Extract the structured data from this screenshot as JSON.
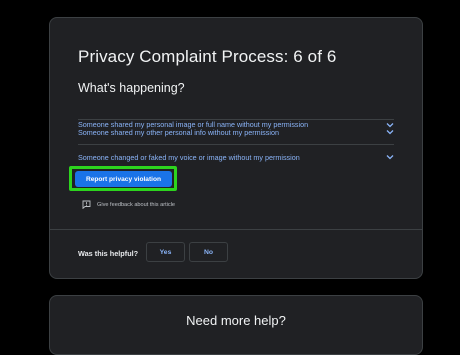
{
  "process": {
    "title": "Privacy Complaint Process: 6 of 6",
    "subheading": "What's happening?"
  },
  "accordion": [
    {
      "label": "Someone shared my personal image or full name without my permission",
      "icon": "chevron-down-icon"
    },
    {
      "label": "Someone shared my other personal info without my permission",
      "icon": "chevron-down-icon"
    },
    {
      "label": "Someone changed or faked my voice or image without my permission",
      "icon": "chevron-down-icon"
    }
  ],
  "report_button": {
    "label": "Report privacy violation"
  },
  "feedback": {
    "label": "Give feedback about this article",
    "icon": "feedback-icon"
  },
  "helpful": {
    "question": "Was this helpful?",
    "yes": "Yes",
    "no": "No"
  },
  "more_help": {
    "title": "Need more help?"
  },
  "colors": {
    "background": "#000000",
    "card": "#202124",
    "link": "#8ab4f8",
    "primary": "#1a73e8",
    "highlight": "#2dd41e"
  }
}
